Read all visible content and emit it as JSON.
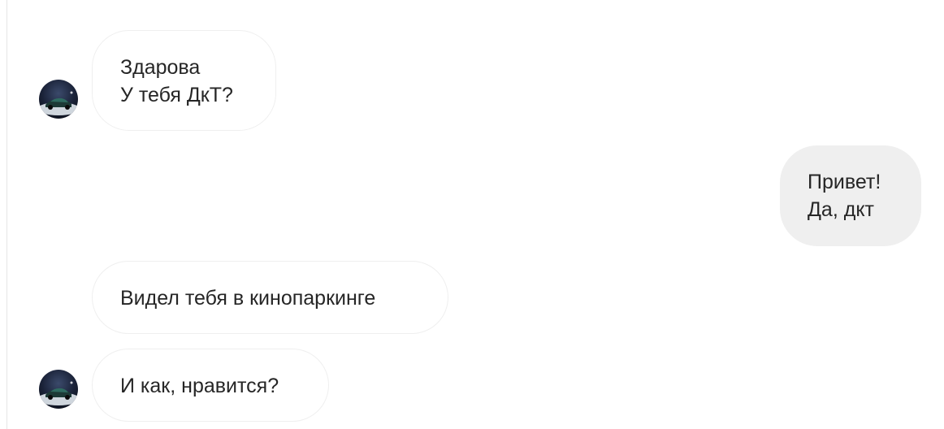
{
  "messages": [
    {
      "direction": "incoming",
      "lines": [
        "Здарова",
        "У тебя ДкТ?"
      ],
      "show_avatar": true
    },
    {
      "direction": "outgoing",
      "lines": [
        "Привет!",
        "Да, дкт"
      ],
      "show_avatar": false
    },
    {
      "direction": "incoming",
      "lines": [
        "Видел тебя в кинопаркинге"
      ],
      "show_avatar": false
    },
    {
      "direction": "incoming",
      "lines": [
        "И как, нравится?"
      ],
      "show_avatar": true
    }
  ],
  "avatar": {
    "icon": "car-photo-avatar-icon"
  },
  "colors": {
    "incoming_bubble": "#ffffff",
    "incoming_border": "#efefef",
    "outgoing_bubble": "#efefef",
    "text": "#262626"
  }
}
